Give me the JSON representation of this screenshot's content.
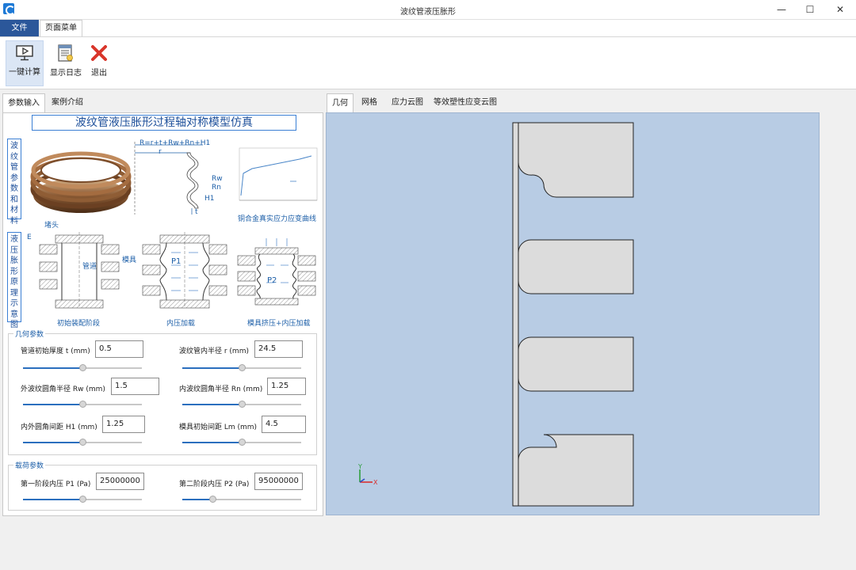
{
  "window": {
    "title": "波纹管液压胀形",
    "minimize": "—",
    "maximize": "☐",
    "close": "✕"
  },
  "menu": {
    "file": "文件",
    "page_menu": "页面菜单"
  },
  "toolbar": {
    "calculate": "一键计算",
    "show_log": "显示日志",
    "exit": "退出"
  },
  "left_tabs": [
    "参数输入",
    "案例介绍"
  ],
  "panel_title": "波纹管液压胀形过程轴对称模型仿真",
  "side_label_1": "波纹管参数和材料",
  "side_label_2": "液压胀形原理示意图",
  "figure": {
    "formula": "R=r+t+Rw+Rn+H1",
    "r": "r",
    "rw": "Rw",
    "rn": "Rn",
    "h1": "H1",
    "t": "t",
    "curve_caption": "铜合金真实应力应变曲线",
    "plug": "堵头",
    "e": "E",
    "pipe": "管道",
    "die": "模具",
    "p1": "P1",
    "p2": "P2",
    "stage1": "初始装配阶段",
    "stage2": "内压加载",
    "stage3": "模具挤压+内压加载"
  },
  "geometry": {
    "legend": "几何参数",
    "t_label": "管道初始厚度 t (mm)",
    "t_value": "0.5",
    "t_slider": 0.5,
    "r_label": "波纹管内半径 r (mm)",
    "r_value": "24.5",
    "r_slider": 0.5,
    "rw_label": "外波纹圆角半径 Rw (mm)",
    "rw_value": "1.5",
    "rw_slider": 0.5,
    "rn_label": "内波纹圆角半径 Rn (mm)",
    "rn_value": "1.25",
    "rn_slider": 0.5,
    "h1_label": "内外圆角间距 H1 (mm)",
    "h1_value": "1.25",
    "h1_slider": 0.5,
    "lm_label": "模具初始间距 Lm (mm)",
    "lm_value": "4.5",
    "lm_slider": 0.5
  },
  "load": {
    "legend": "载荷参数",
    "p1_label": "第一阶段内压 P1 (Pa)",
    "p1_value": "25000000",
    "p1_slider": 0.5,
    "p2_label": "第二阶段内压 P2 (Pa)",
    "p2_value": "95000000",
    "p2_slider": 0.25
  },
  "right_tabs": [
    "几何",
    "网格",
    "应力云图",
    "等效塑性应变云图"
  ],
  "axis": {
    "y": "Y",
    "x": "X"
  },
  "colors": {
    "accent": "#2b579a",
    "viewport_bg": "#b8cce4",
    "part_fill": "#dcdcdc"
  }
}
